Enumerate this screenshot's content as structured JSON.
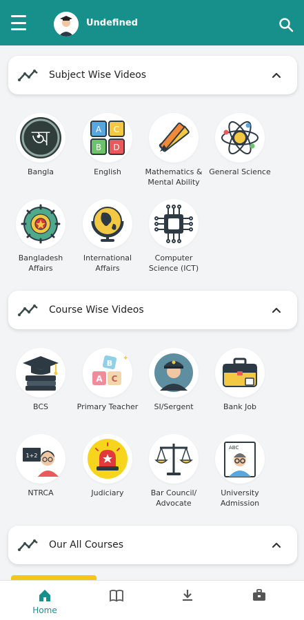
{
  "header": {
    "title": "Undefined",
    "menu_icon": "hamburger-icon",
    "search_icon": "search-icon",
    "avatar_icon": "graduate-avatar-icon"
  },
  "colors": {
    "primary": "#17908c",
    "accent_strip": "#f5c518",
    "background": "#f2f4f5"
  },
  "sections": {
    "subject": {
      "title": "Subject Wise Videos",
      "expanded": true,
      "items": [
        {
          "label": "Bangla",
          "icon": "bangla-letter-icon"
        },
        {
          "label": "English",
          "icon": "abcd-blocks-icon"
        },
        {
          "label": "Mathematics & Mental Ability",
          "icon": "pencil-ruler-icon"
        },
        {
          "label": "General Science",
          "icon": "atom-icon"
        },
        {
          "label": "Bangladesh Affairs",
          "icon": "bangladesh-emblem-icon"
        },
        {
          "label": "International Affairs",
          "icon": "globe-icon"
        },
        {
          "label": "Computer Science (ICT)",
          "icon": "chip-icon"
        }
      ]
    },
    "course": {
      "title": "Course Wise Videos",
      "expanded": true,
      "items": [
        {
          "label": "BCS",
          "icon": "books-cap-icon"
        },
        {
          "label": "Primary Teacher",
          "icon": "toy-blocks-icon"
        },
        {
          "label": "SI/Sergent",
          "icon": "police-officer-icon"
        },
        {
          "label": "Bank Job",
          "icon": "briefcase-icon"
        },
        {
          "label": "NTRCA",
          "icon": "teacher-board-icon"
        },
        {
          "label": "Judiciary",
          "icon": "siren-icon"
        },
        {
          "label": "Bar Council/ Advocate",
          "icon": "scales-icon"
        },
        {
          "label": "University Admission",
          "icon": "student-glasses-icon"
        }
      ]
    },
    "all_courses": {
      "title": "Our All Courses",
      "expanded": true
    }
  },
  "bottom_nav": {
    "items": [
      {
        "label": "Home",
        "icon": "home-icon",
        "active": true
      },
      {
        "label": "",
        "icon": "book-open-icon",
        "active": false
      },
      {
        "label": "",
        "icon": "download-icon",
        "active": false
      },
      {
        "label": "",
        "icon": "briefcase-icon",
        "active": false
      }
    ]
  }
}
